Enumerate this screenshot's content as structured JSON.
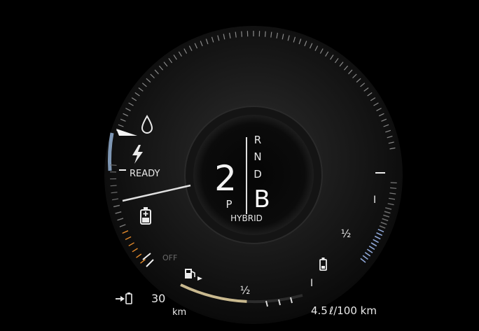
{
  "colors": {
    "background": "#000000",
    "text": "#ececec",
    "power_accent": "#7e96b3",
    "charge_accent": "#e48a2b",
    "fuel_fill": "#c9b98f",
    "battery_fill": "#8ea6d6"
  },
  "power_gauge": {
    "ready_label": "READY",
    "off_label": "OFF",
    "icons": [
      "droplet-icon",
      "lightning-icon",
      "battery-plus-icon"
    ]
  },
  "gear": {
    "current": "2",
    "park": "P",
    "options": [
      "R",
      "N",
      "D"
    ],
    "selected_mode": "B",
    "drive_mode": "HYBRID"
  },
  "fuel_gauge": {
    "half_label": "½",
    "level": 0.55,
    "icon": "fuel-pump-icon"
  },
  "battery_gauge": {
    "full_label": "I",
    "half_label": "½",
    "empty_label": "I",
    "level": 0.6,
    "icon": "battery-icon"
  },
  "range": {
    "icon": "plug-to-battery-icon",
    "value": "30",
    "unit": "km"
  },
  "consumption": {
    "value": "4.5",
    "unit": "ℓ/100 km"
  }
}
